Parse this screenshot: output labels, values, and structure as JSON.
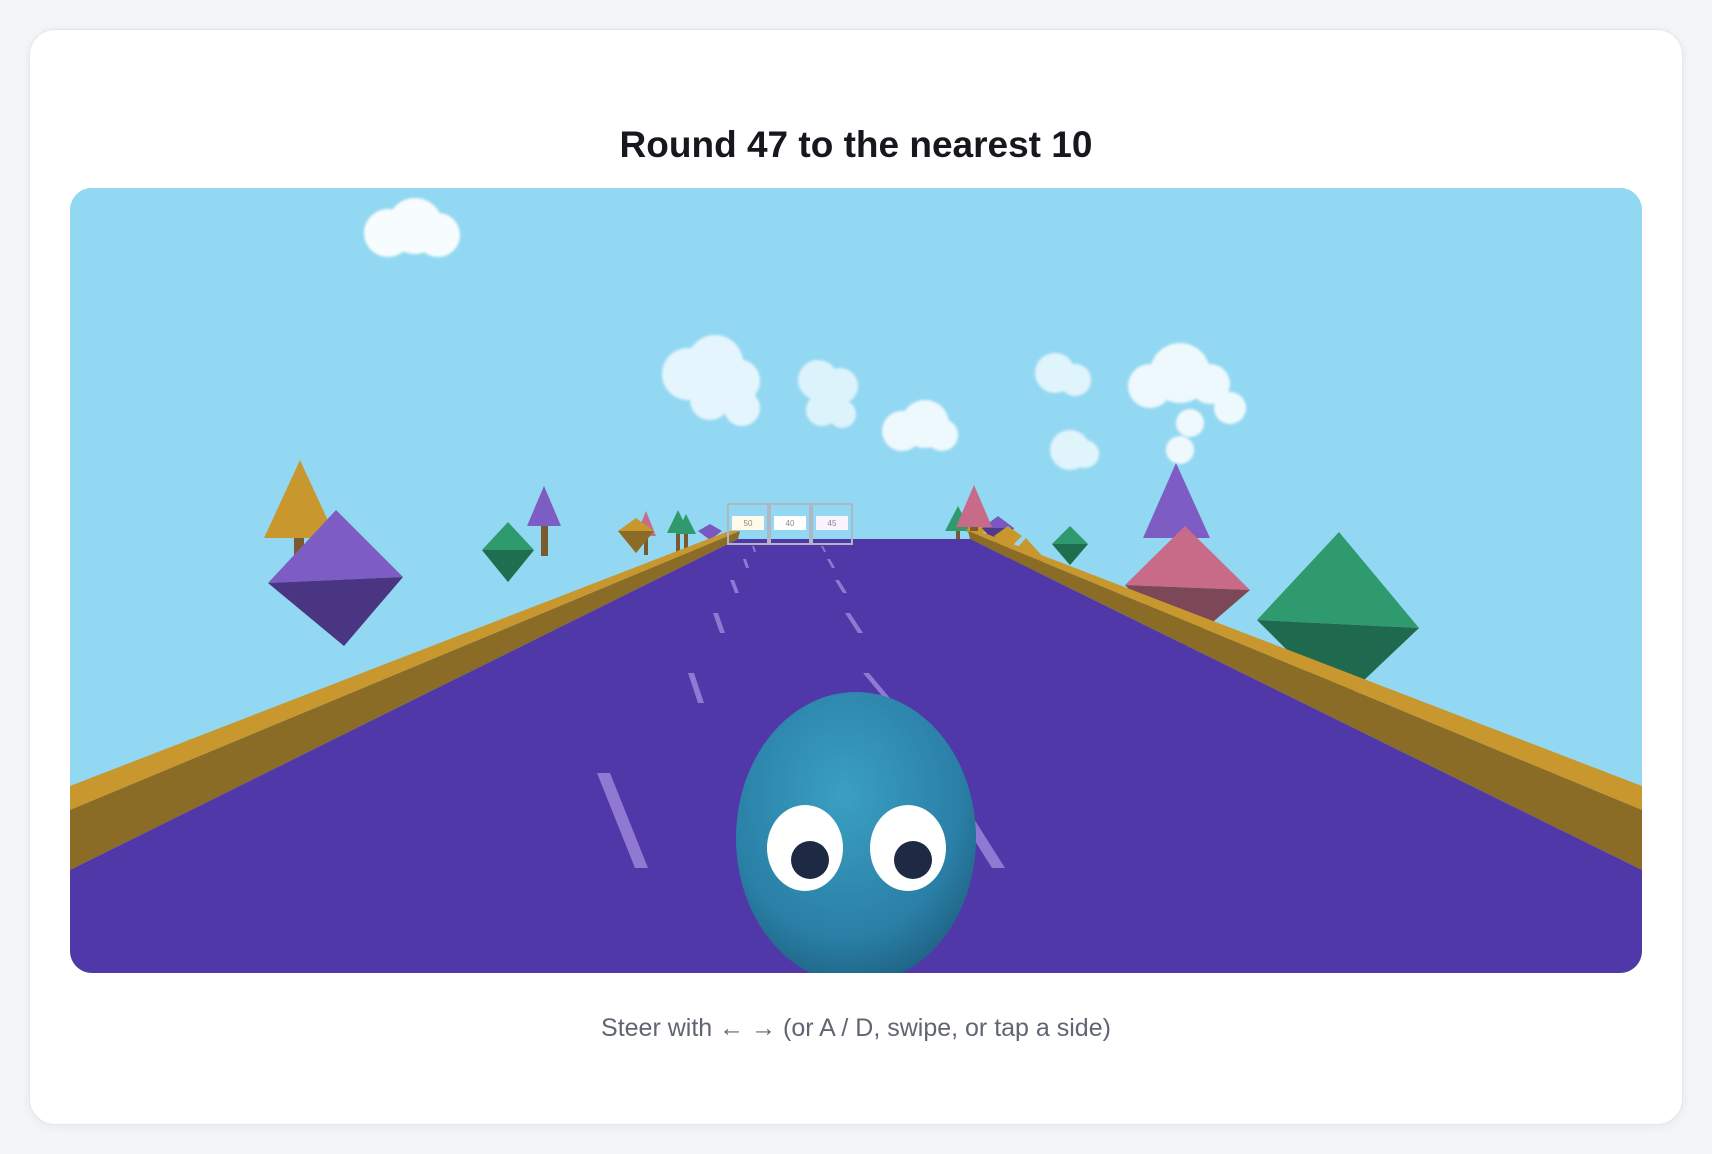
{
  "question": {
    "title": "Round 47 to the nearest 10"
  },
  "game": {
    "answer_gates": [
      {
        "label": "50"
      },
      {
        "label": "40"
      },
      {
        "label": "45"
      }
    ],
    "player": {
      "character": "blue-blob-with-eyes"
    },
    "colors": {
      "sky": "#93d8f2",
      "road": "#5138a8",
      "rail_top": "#c8982e",
      "rail_side": "#8a6c26",
      "player": "#2d8cb3"
    }
  },
  "instructions": {
    "hint": "Steer with ← → (or A / D, swipe, or tap a side)"
  }
}
